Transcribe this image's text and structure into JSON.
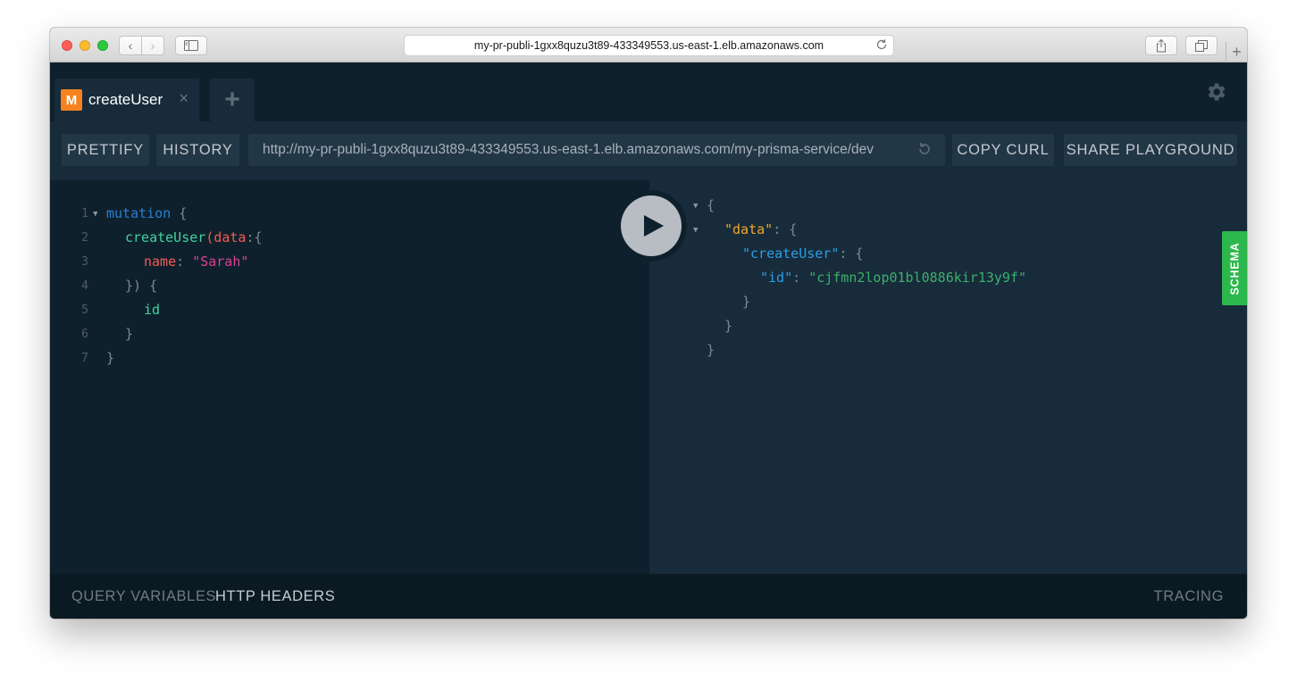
{
  "browser": {
    "address": "my-pr-publi-1gxx8quzu3t89-433349553.us-east-1.elb.amazonaws.com",
    "back_glyph": "‹",
    "forward_glyph": "›",
    "new_tab_glyph": "+"
  },
  "tabs": [
    {
      "badge": "M",
      "title": "createUser",
      "close": "×"
    }
  ],
  "add_tab_label": "+",
  "toolbar": {
    "prettify": "PRETTIFY",
    "history": "HISTORY",
    "endpoint": "http://my-pr-publi-1gxx8quzu3t89-433349553.us-east-1.elb.amazonaws.com/my-prisma-service/dev",
    "copy_curl": "COPY CURL",
    "share": "SHARE PLAYGROUND"
  },
  "query_editor": {
    "line_numbers": [
      "1",
      "2",
      "3",
      "4",
      "5",
      "6",
      "7"
    ],
    "mutation_kw": "mutation",
    "open_brace": "{",
    "create_fn": "createUser",
    "paren_open": "(",
    "data_arg": "data",
    "colon_brace": ":{",
    "name_arg": "name",
    "colon": ":",
    "name_value": "\"Sarah\"",
    "close_args": "}) {",
    "id_field": "id",
    "inner_close": "}",
    "outer_close": "}"
  },
  "result": {
    "open": "{",
    "data_key": "\"data\"",
    "create_key": "\"createUser\"",
    "id_key": "\"id\"",
    "id_value": "\"cjfmn2lop01bl0886kir13y9f\"",
    "colon_brace": ": {",
    "colon": ": ",
    "close": "}"
  },
  "schema_label": "SCHEMA",
  "footer": {
    "query_variables": "QUERY VARIABLES",
    "http_headers": "HTTP HEADERS",
    "tracing": "TRACING"
  },
  "colors": {
    "badge": "#f5821f",
    "schema_tab": "#2db84d",
    "keyword": "#2a7ed2",
    "field": "#42d3a0",
    "string": "#d64292",
    "json_key": "#f5a623",
    "json_string": "#3cb06d"
  }
}
